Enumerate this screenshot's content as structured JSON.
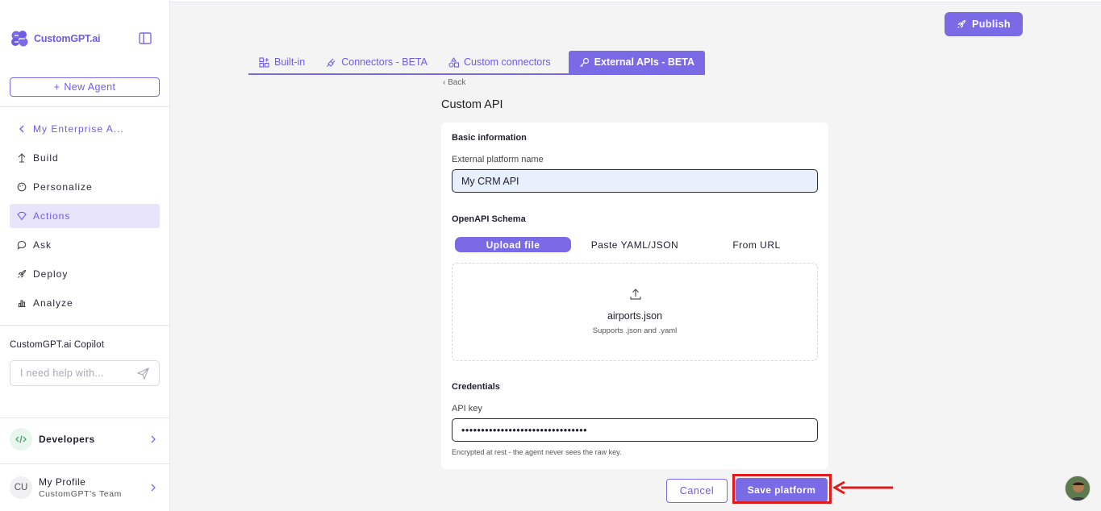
{
  "sidebar": {
    "brand": "CustomGPT.ai",
    "new_agent": "New Agent",
    "back_label": "My Enterprise A...",
    "items": [
      {
        "label": "Build",
        "icon": "build-icon"
      },
      {
        "label": "Personalize",
        "icon": "palette-icon"
      },
      {
        "label": "Actions",
        "icon": "actions-icon",
        "active": true
      },
      {
        "label": "Ask",
        "icon": "chat-icon"
      },
      {
        "label": "Deploy",
        "icon": "rocket-icon"
      },
      {
        "label": "Analyze",
        "icon": "chart-icon"
      }
    ],
    "copilot_title": "CustomGPT.ai Copilot",
    "copilot_placeholder": "I need help with...",
    "developers": "Developers",
    "profile_initials": "CU",
    "profile_name": "My Profile",
    "profile_team": "CustomGPT's Team"
  },
  "header": {
    "publish": "Publish"
  },
  "tabs": [
    {
      "label": "Built-in",
      "icon": "grid-icon"
    },
    {
      "label": "Connectors - BETA",
      "icon": "plug-icon"
    },
    {
      "label": "Custom connectors",
      "icon": "shapes-icon"
    },
    {
      "label": "External APIs - BETA",
      "icon": "key-icon",
      "active": true
    }
  ],
  "form": {
    "back": "Back",
    "title": "Custom API",
    "basic_info": "Basic information",
    "platform_name_label": "External platform name",
    "platform_name_value": "My CRM API",
    "schema_label": "OpenAPI Schema",
    "schema_options": [
      "Upload file",
      "Paste YAML/JSON",
      "From URL"
    ],
    "uploaded_file": "airports.json",
    "upload_hint": "Supports .json and .yaml",
    "credentials": "Credentials",
    "api_key_label": "API key",
    "api_key_value": "••••••••••••••••••••••••••••••••",
    "api_key_hint": "Encrypted at rest - the agent never sees the raw key.",
    "cancel": "Cancel",
    "save": "Save platform"
  },
  "colors": {
    "accent": "#7b6ae6",
    "accent_text": "#6d5ce8",
    "annotation": "#e01b1b"
  }
}
